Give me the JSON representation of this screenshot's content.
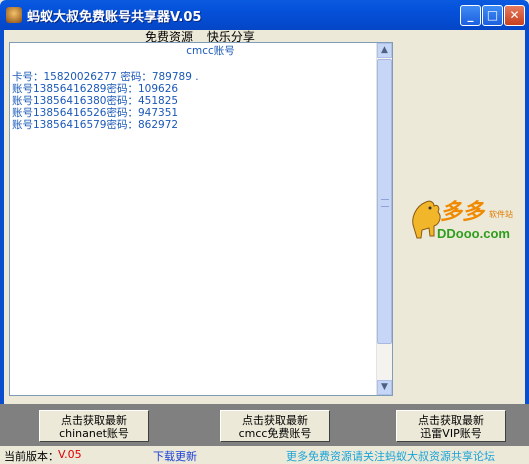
{
  "window": {
    "title": "蚂蚁大叔免费账号共享器V.05",
    "minimize_label": "_",
    "maximize_label": "□",
    "close_label": "✕"
  },
  "tabs": [
    "免费资源",
    "快乐分享"
  ],
  "content": {
    "heading": "cmcc账号",
    "lines": [
      "卡号：15820026277 密码：789789 .",
      "账号13856416289密码：109626",
      "账号13856416380密码：451825",
      "账号13856416526密码：947351",
      "账号13856416579密码：862972"
    ]
  },
  "scrollbar": {
    "up": "▲",
    "down": "▼"
  },
  "logo": {
    "chinese": "多多",
    "small": "软件站",
    "english": "DDooo.com"
  },
  "buttons": [
    {
      "line1": "点击获取最新",
      "line2": "chinanet账号"
    },
    {
      "line1": "点击获取最新",
      "line2": "cmcc免费账号"
    },
    {
      "line1": "点击获取最新",
      "line2": "迅雷VIP账号"
    }
  ],
  "status": {
    "label": "当前版本：",
    "version": "V.05",
    "download": "下载更新",
    "marquee": "更多免费资源请关注蚂蚁大叔资源共享论坛"
  },
  "colors": {
    "titlebar": "#0A5AE0",
    "text_blue": "#1a58b8",
    "version_red": "#e00000"
  }
}
